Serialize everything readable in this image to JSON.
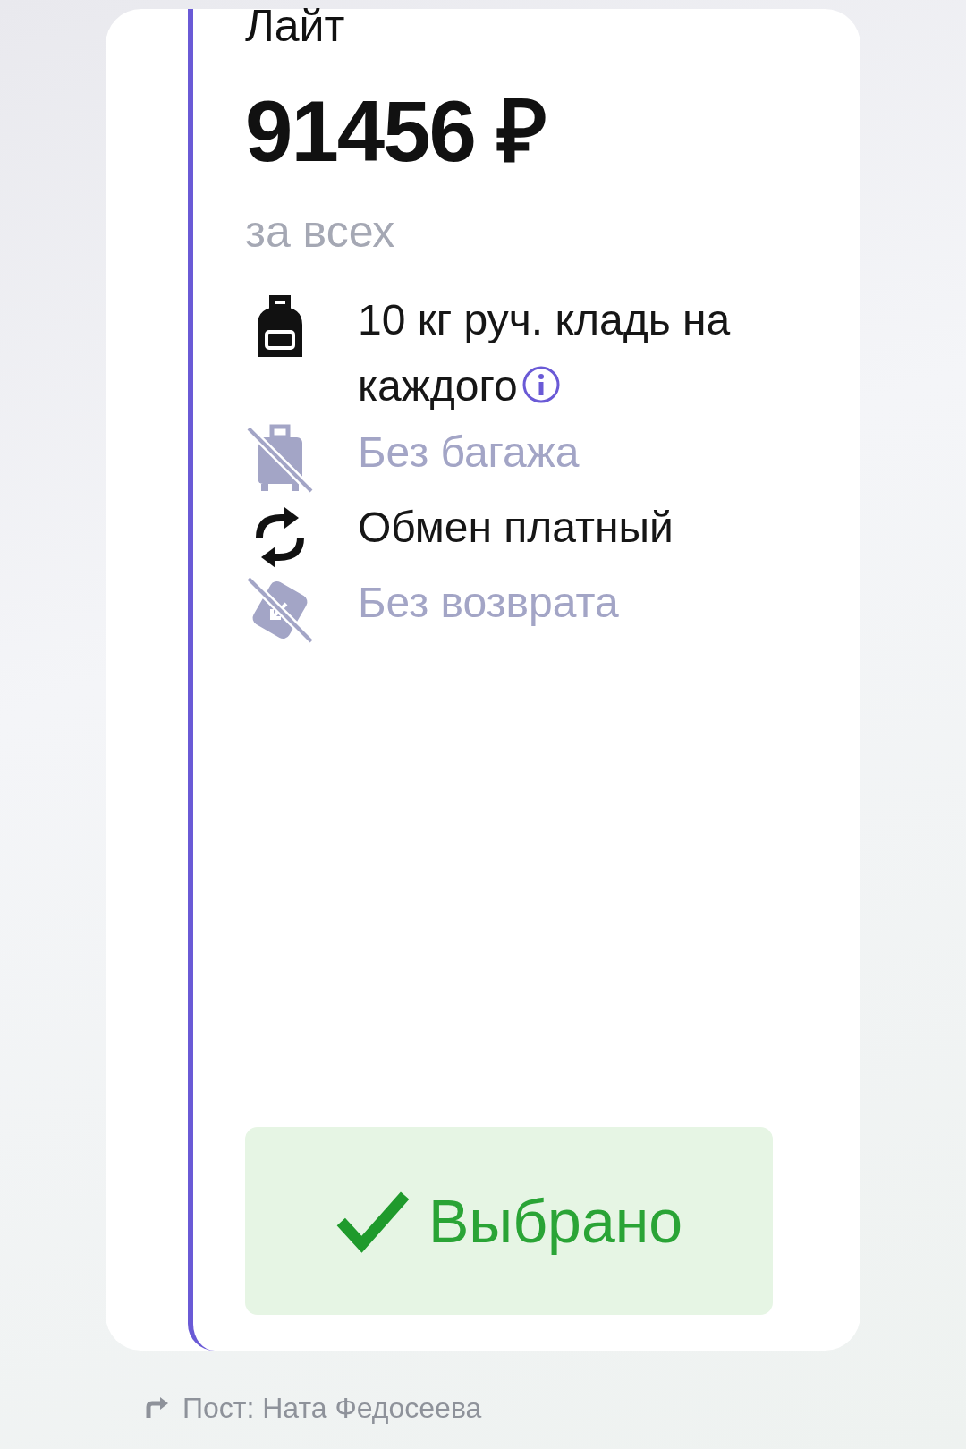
{
  "tariff": {
    "title": "Лайт",
    "price": "91456 ₽",
    "price_note": "за всех",
    "features": [
      {
        "kind": "hand_luggage",
        "text": "10 кг руч. кладь на каждого",
        "available": true,
        "info": true
      },
      {
        "kind": "luggage",
        "text": "Без багажа",
        "available": false,
        "info": false
      },
      {
        "kind": "exchange",
        "text": "Обмен платный",
        "available": true,
        "info": false
      },
      {
        "kind": "refund",
        "text": "Без возврата",
        "available": false,
        "info": false
      }
    ],
    "button": {
      "label": "Выбрано",
      "selected": true
    }
  },
  "footer": {
    "text": "Пост: Ната Федосеева"
  }
}
